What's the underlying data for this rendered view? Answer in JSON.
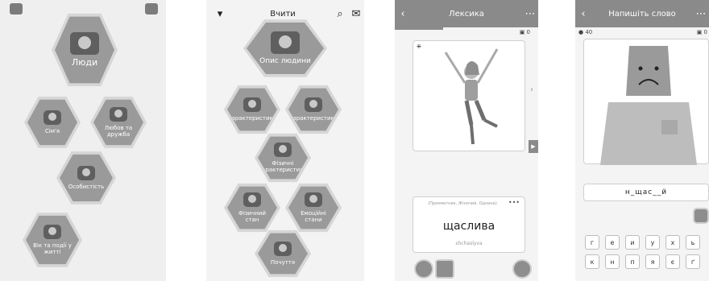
{
  "screen1": {
    "tiles": {
      "people": "Люди",
      "family": "Сім'я",
      "love": "Любов та дружба",
      "personality": "Особистість",
      "age": "Вік та події у житті"
    }
  },
  "screen2": {
    "title": "Вчити",
    "tiles": {
      "describe": "Опис людини",
      "char1": "Характеристики",
      "char2": "Характеристики",
      "physical": "Фізичні характеристики",
      "physical_state": "Фізичний стан",
      "emotional": "Емоційні стани",
      "feelings": "Почуття"
    }
  },
  "screen3": {
    "title": "Лексика",
    "counter": "0",
    "pos": "(Прикметник, Жіночий, Однина)",
    "more": "•••",
    "word": "щаслива",
    "translit": "shchaslyva"
  },
  "screen4": {
    "title": "Напишіть слово",
    "coins": "40",
    "score": "0",
    "answer": "н_щас__й",
    "keys_row1": [
      "г",
      "е",
      "и",
      "у",
      "х",
      "ь"
    ],
    "keys_row2": [
      "к",
      "н",
      "п",
      "я",
      "є",
      "ґ"
    ]
  }
}
